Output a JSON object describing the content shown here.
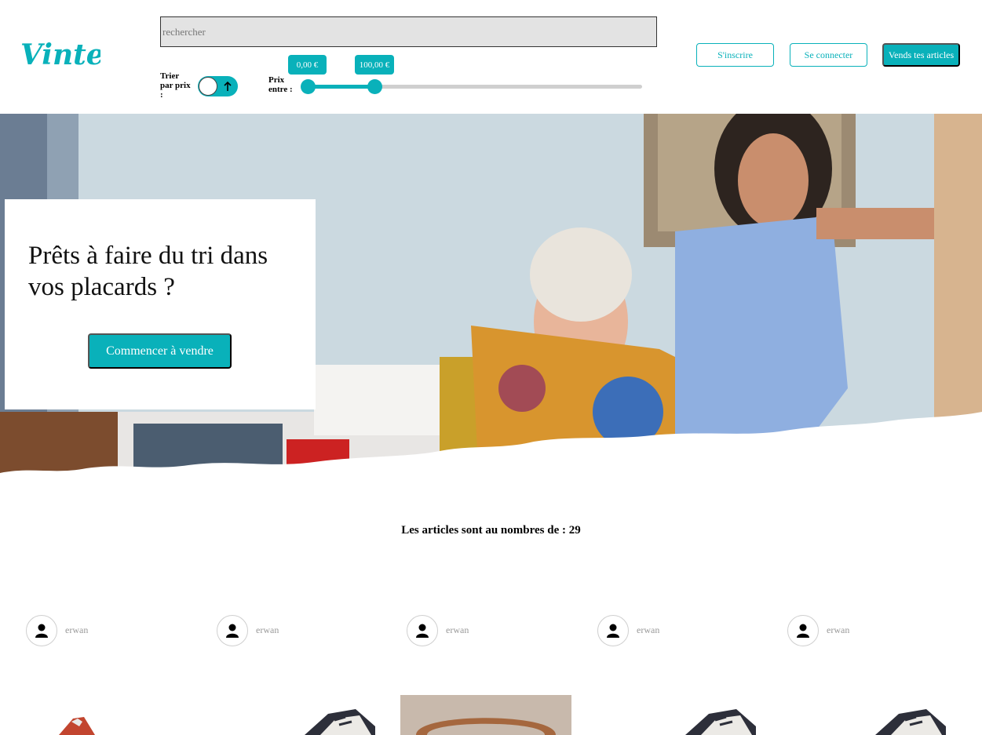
{
  "brand": {
    "name": "Vinted",
    "accent": "#09b1ba"
  },
  "search": {
    "placeholder": "rechercher"
  },
  "sort": {
    "label": "Trier par prix :",
    "direction_icon": "arrow-up-icon"
  },
  "price_filter": {
    "label": "Prix entre :",
    "min_display": "0,00 €",
    "max_display": "100,00 €"
  },
  "nav": {
    "signup_label": "S'inscrire",
    "login_label": "Se connecter",
    "sell_label": "Vends tes articles"
  },
  "hero": {
    "title": "Prêts à faire du tri dans vos placards ?",
    "cta_label": "Commencer à vendre"
  },
  "catalog": {
    "count_text": "Les articles sont au nombres de : 29"
  },
  "articles": [
    {
      "username": "erwan",
      "thumb": "shirt"
    },
    {
      "username": "erwan",
      "thumb": "sneaker"
    },
    {
      "username": "erwan",
      "thumb": "belt"
    },
    {
      "username": "erwan",
      "thumb": "sneaker"
    },
    {
      "username": "erwan",
      "thumb": "sneaker"
    }
  ]
}
